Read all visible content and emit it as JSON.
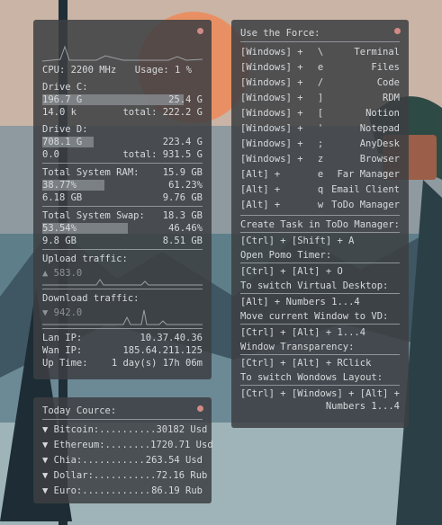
{
  "system": {
    "cpu_label": "CPU: 2200 MHz",
    "usage_label": "Usage: 1 %",
    "drive_c": {
      "title": "Drive C:",
      "used": "196.7 G",
      "free": "25.4 G",
      "io": "14.0 k",
      "total": "total: 222.2 G",
      "fill_fraction": 0.88
    },
    "drive_d": {
      "title": "Drive D:",
      "used": "708.1 G",
      "free": "223.4 G",
      "io": "0.0",
      "total": "total: 931.5 G",
      "fill_fraction": 0.32
    },
    "ram": {
      "title": "Total System RAM:",
      "total": "15.9 GB",
      "used_pct": "38.77%",
      "free_pct": "61.23%",
      "used": "6.18 GB",
      "free": "9.76 GB",
      "fill_fraction": 0.3877
    },
    "swap": {
      "title": "Total System Swap:",
      "total": "18.3 GB",
      "used_pct": "53.54%",
      "free_pct": "46.46%",
      "used": "9.8 GB",
      "free": "8.51 GB",
      "fill_fraction": 0.5354
    },
    "upload": {
      "title": "Upload traffic:",
      "value": "▲ 583.0"
    },
    "download": {
      "title": "Download traffic:",
      "value": "▼ 942.0"
    },
    "lan_label": "Lan IP:",
    "lan_ip": "10.37.40.36",
    "wan_label": "Wan IP:",
    "wan_ip": "185.64.211.125",
    "uptime_label": "Up Time:",
    "uptime": "1 day(s) 17h 06m"
  },
  "course": {
    "title": "Today Cource:",
    "items": [
      {
        "name": "▼ Bitcoin:..........",
        "value": "30182 Usd"
      },
      {
        "name": "▼ Ethereum:........",
        "value": "1720.71 Usd"
      },
      {
        "name": "▼ Chia:...........",
        "value": "263.54 Usd"
      },
      {
        "name": "▼ Dollar:...........",
        "value": "72.16 Rub"
      },
      {
        "name": "▼ Euro:............",
        "value": "86.19 Rub"
      }
    ]
  },
  "shortcuts": {
    "title": "Use the Force:",
    "items": [
      {
        "mod": "[Windows] +",
        "key": "\\",
        "action": "Terminal"
      },
      {
        "mod": "[Windows] +",
        "key": "e",
        "action": "Files"
      },
      {
        "mod": "[Windows] +",
        "key": "/",
        "action": "Code"
      },
      {
        "mod": "[Windows] +",
        "key": "]",
        "action": "RDM"
      },
      {
        "mod": "[Windows] +",
        "key": "[",
        "action": "Notion"
      },
      {
        "mod": "[Windows] +",
        "key": "'",
        "action": "Notepad"
      },
      {
        "mod": "[Windows] +",
        "key": ";",
        "action": "AnyDesk"
      },
      {
        "mod": "[Windows] +",
        "key": "z",
        "action": "Browser"
      },
      {
        "mod": "[Alt] +",
        "key": "e",
        "action": "Far Manager"
      },
      {
        "mod": "[Alt] +",
        "key": "q",
        "action": "Email Client"
      },
      {
        "mod": "[Alt] +",
        "key": "w",
        "action": "ToDo Manager"
      }
    ],
    "tips": [
      {
        "label": "Create Task in ToDo Manager:",
        "combo": "[Ctrl] + [Shift] + A"
      },
      {
        "label": "Open Pomo Timer:",
        "combo": "[Ctrl] + [Alt] + O"
      },
      {
        "label": "To switch Virtual Desktop:",
        "combo": "[Alt] + Numbers 1...4"
      },
      {
        "label": "Move current Window to VD:",
        "combo": "[Ctrl] + [Alt] + 1...4"
      },
      {
        "label": "Window Transparency:",
        "combo": "[Ctrl] + [Alt] + RClick"
      }
    ],
    "layout_label": "To switch Wondows Layout:",
    "layout_combo_1": "[Ctrl] + [Windows] + [Alt] +",
    "layout_combo_2": "Numbers 1...4"
  }
}
